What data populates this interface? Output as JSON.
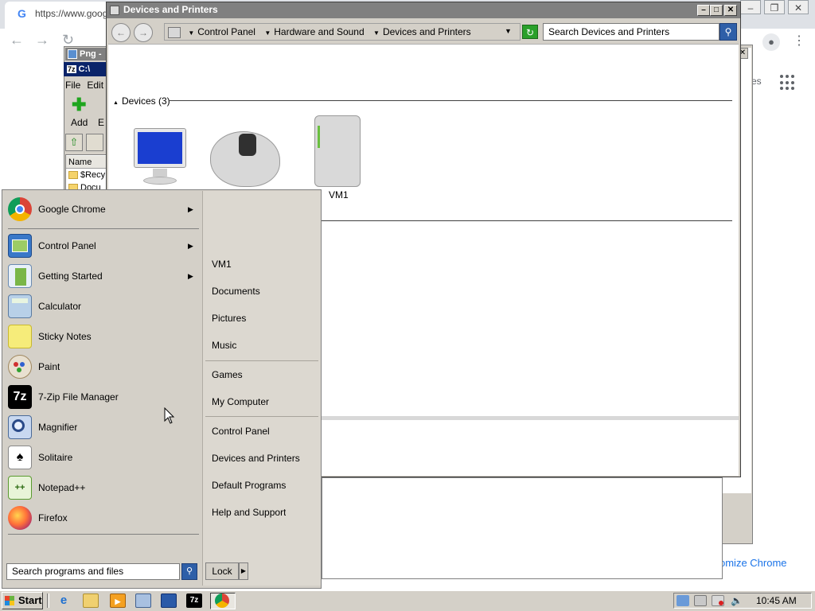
{
  "chrome": {
    "url": "https://www.goog",
    "customize": "omize Chrome",
    "side_text": "es"
  },
  "zip": {
    "png_title": "Png -",
    "title": "C:\\",
    "menu": [
      "File",
      "Edit"
    ],
    "add_label": "Add",
    "e_label": "E",
    "col_name": "Name",
    "rows": [
      "$Recy",
      "Docu"
    ]
  },
  "devices_window": {
    "title": "Devices and Printers",
    "breadcrumb": [
      "Control Panel",
      "Hardware and Sound",
      "Devices and Printers"
    ],
    "search_placeholder": "Search Devices and Printers",
    "devices_header": "Devices (3)",
    "device_label": "VM1"
  },
  "start_menu": {
    "programs": [
      {
        "label": "Google Chrome",
        "icon": "chrome-icon",
        "submenu": true
      },
      {
        "label": "Control Panel",
        "icon": "control-panel-icon",
        "submenu": true
      },
      {
        "label": "Getting Started",
        "icon": "getting-started-icon",
        "submenu": true
      },
      {
        "label": "Calculator",
        "icon": "calculator-icon",
        "submenu": false
      },
      {
        "label": "Sticky Notes",
        "icon": "sticky-notes-icon",
        "submenu": false
      },
      {
        "label": "Paint",
        "icon": "paint-icon",
        "submenu": false
      },
      {
        "label": "7-Zip File Manager",
        "icon": "7zip-icon",
        "submenu": false
      },
      {
        "label": "Magnifier",
        "icon": "magnifier-icon",
        "submenu": false
      },
      {
        "label": "Solitaire",
        "icon": "solitaire-icon",
        "submenu": false
      },
      {
        "label": "Notepad++",
        "icon": "notepadpp-icon",
        "submenu": false
      },
      {
        "label": "Firefox",
        "icon": "firefox-icon",
        "submenu": false
      }
    ],
    "places": [
      "VM1",
      "Documents",
      "Pictures",
      "Music",
      "Games",
      "My Computer",
      "Control Panel",
      "Devices and Printers",
      "Default Programs",
      "Help and Support"
    ],
    "search_placeholder": "Search programs and files",
    "lock_label": "Lock",
    "icon_7zip_text": "7z"
  },
  "taskbar": {
    "start_label": "Start",
    "quick_launch": [
      "ie-icon",
      "explorer-icon",
      "media-player-icon",
      "network-icon",
      "remote-desktop-icon",
      "7zip-icon",
      "chrome-icon"
    ],
    "ql_7z": "7z",
    "clock": "10:45 AM"
  },
  "colors": {
    "title_inactive": "#808080",
    "title_active": "#0a246a",
    "classic_face": "#d4d0c8",
    "accent_blue": "#2e5fa8"
  }
}
